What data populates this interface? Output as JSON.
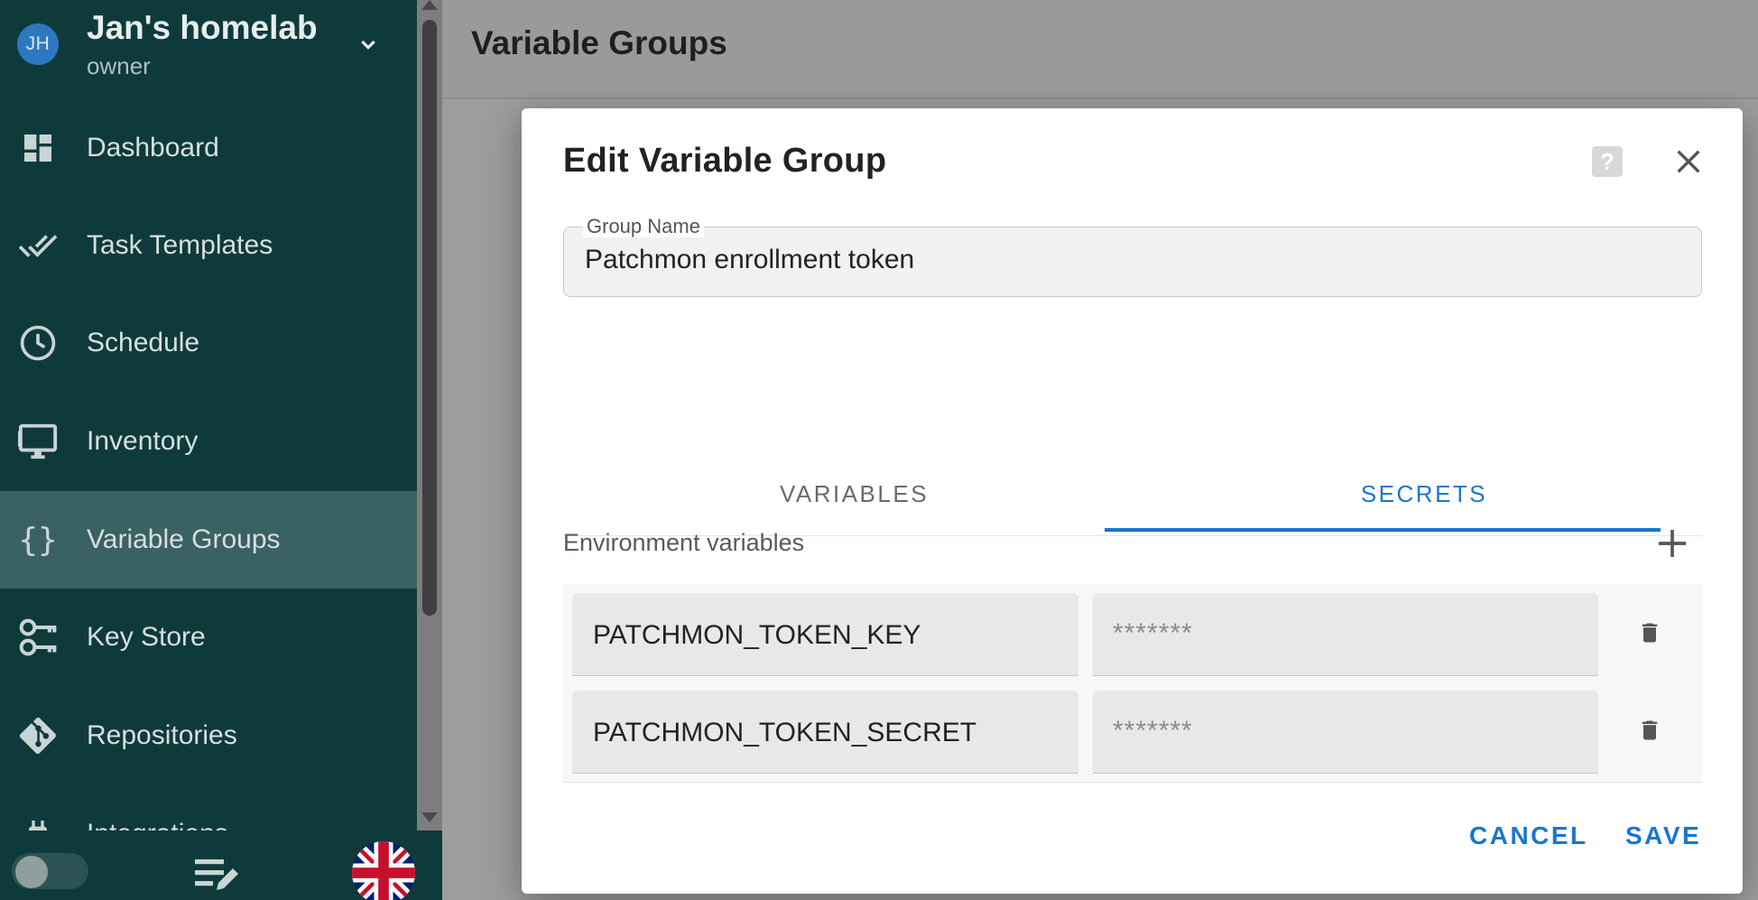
{
  "team": {
    "initials": "JH",
    "name": "Jan's homelab",
    "role": "owner"
  },
  "nav": {
    "items": [
      {
        "label": "Dashboard",
        "icon": "dashboard-icon",
        "active": false
      },
      {
        "label": "Task Templates",
        "icon": "done-all-icon",
        "active": false
      },
      {
        "label": "Schedule",
        "icon": "clock-icon",
        "active": false
      },
      {
        "label": "Inventory",
        "icon": "monitor-icon",
        "active": false
      },
      {
        "label": "Variable Groups",
        "icon": "braces-icon",
        "active": true
      },
      {
        "label": "Key Store",
        "icon": "key-icon",
        "active": false
      },
      {
        "label": "Repositories",
        "icon": "git-icon",
        "active": false
      },
      {
        "label": "Integrations",
        "icon": "plug-icon",
        "active": false
      }
    ]
  },
  "page": {
    "title": "Variable Groups"
  },
  "modal": {
    "title": "Edit Variable Group",
    "group_name_label": "Group Name",
    "group_name_value": "Patchmon enrollment token",
    "tabs": [
      {
        "label": "VARIABLES",
        "active": false
      },
      {
        "label": "SECRETS",
        "active": true
      }
    ],
    "env_label": "Environment variables",
    "secrets": [
      {
        "name": "PATCHMON_TOKEN_KEY",
        "value": "*******"
      },
      {
        "name": "PATCHMON_TOKEN_SECRET",
        "value": "*******"
      }
    ],
    "cancel_label": "CANCEL",
    "save_label": "SAVE"
  },
  "colors": {
    "sidebar": "#0f3a3c",
    "sidebar_active": "#3a6163",
    "accent": "#1976d2"
  }
}
